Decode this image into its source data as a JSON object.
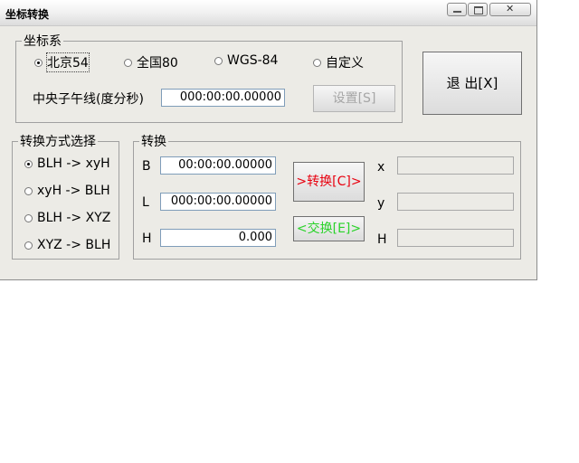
{
  "window": {
    "title": "坐标转换"
  },
  "coord_group": {
    "label": "坐标系",
    "options": [
      {
        "label": "北京54",
        "checked": true
      },
      {
        "label": "全国80",
        "checked": false
      },
      {
        "label": "WGS-84",
        "checked": false
      },
      {
        "label": "自定义",
        "checked": false
      }
    ],
    "meridian_label": "中央子午线(度分秒)",
    "meridian_value": "000:00:00.00000",
    "set_button": "设置[S]"
  },
  "exit_button": "退 出[X]",
  "method_group": {
    "label": "转换方式选择",
    "options": [
      {
        "label": "BLH -> xyH",
        "checked": true
      },
      {
        "label": "xyH -> BLH",
        "checked": false
      },
      {
        "label": "BLH -> XYZ",
        "checked": false
      },
      {
        "label": "XYZ -> BLH",
        "checked": false
      }
    ]
  },
  "convert_group": {
    "label": "转换",
    "input_labels": [
      "B",
      "L",
      "H"
    ],
    "input_values": [
      "00:00:00.00000",
      "000:00:00.00000",
      "0.000"
    ],
    "convert_button": ">转换[C]>",
    "swap_button": "<交换[E]>",
    "output_labels": [
      "x",
      "y",
      "H"
    ],
    "output_values": [
      "",
      "",
      ""
    ]
  },
  "colors": {
    "convert_text": "#e8000f",
    "swap_text": "#2ad22a"
  }
}
